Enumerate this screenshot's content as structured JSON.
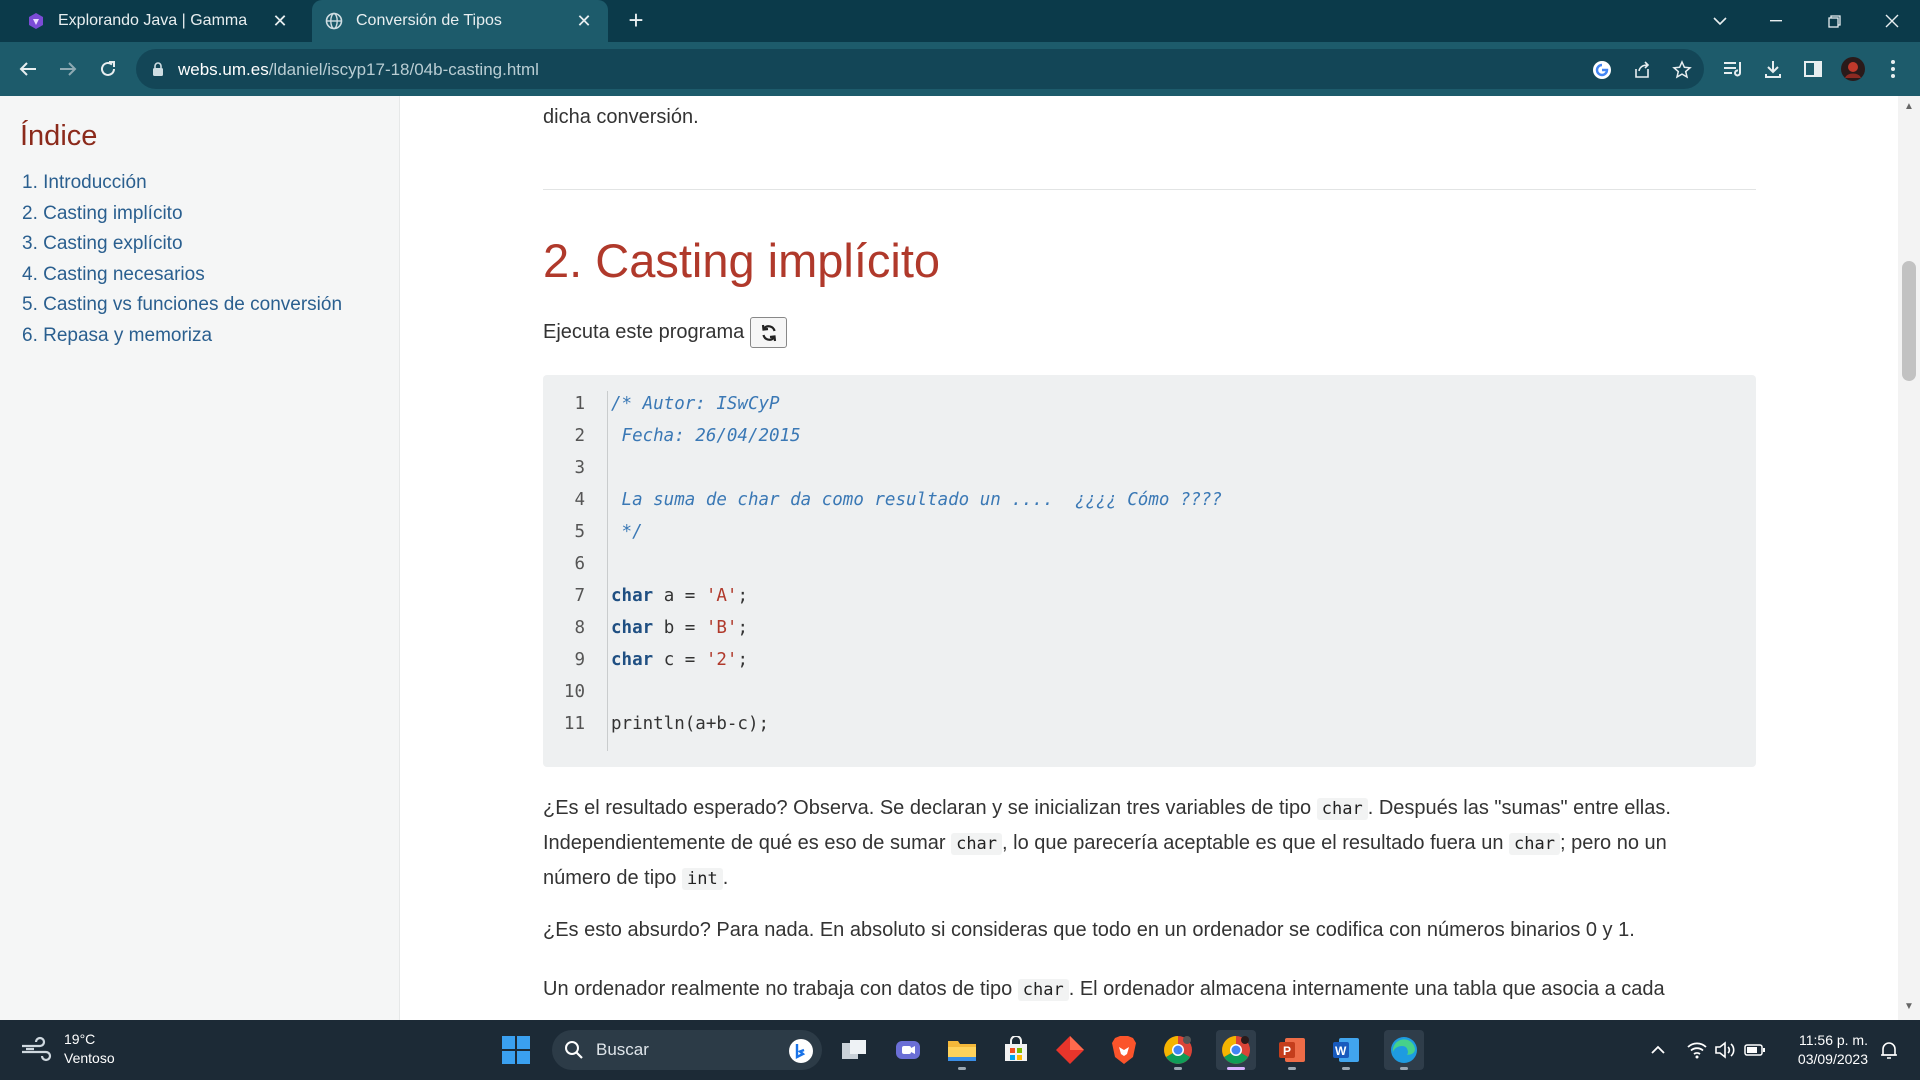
{
  "browser": {
    "tabs": [
      {
        "title": "Explorando Java | Gamma",
        "active": false,
        "icon": "gamma-icon"
      },
      {
        "title": "Conversión de Tipos",
        "active": true,
        "icon": "globe-icon"
      }
    ],
    "url_host": "webs.um.es",
    "url_path": "/ldaniel/iscyp17-18/04b-casting.html"
  },
  "sidebar": {
    "heading": "Índice",
    "items": [
      {
        "label": "1. Introducción"
      },
      {
        "label": "2. Casting implícito"
      },
      {
        "label": "3. Casting explícito"
      },
      {
        "label": "4. Casting necesarios"
      },
      {
        "label": "5. Casting vs funciones de conversión"
      },
      {
        "label": "6. Repasa y memoriza"
      }
    ]
  },
  "main": {
    "intro_tail": "dicha conversión.",
    "section_title": "2. Casting implícito",
    "run_prompt": "Ejecuta este programa",
    "code": {
      "line_numbers": [
        "1",
        "2",
        "3",
        "4",
        "5",
        "6",
        "7",
        "8",
        "9",
        "10",
        "11"
      ],
      "comment_lines": [
        "/* Autor: ISwCyP",
        " Fecha: 26/04/2015",
        "",
        " La suma de char da como resultado un ....  ¿¿¿¿ Cómo ????",
        " */"
      ],
      "decls": [
        {
          "kw": "char",
          "rest": " a = ",
          "lit": "'A'",
          "end": ";"
        },
        {
          "kw": "char",
          "rest": " b = ",
          "lit": "'B'",
          "end": ";"
        },
        {
          "kw": "char",
          "rest": " c = ",
          "lit": "'2'",
          "end": ";"
        }
      ],
      "last_line": "println(a+b-c);"
    },
    "p1": {
      "a": "¿Es el resultado esperado? Observa. Se declaran y se inicializan tres variables de tipo ",
      "code1": "char",
      "b": ". Después las \"sumas\" entre ellas.",
      "c": "Independientemente de qué es eso de sumar ",
      "code2": "char",
      "d": ", lo que parecería aceptable es que el resultado fuera un ",
      "code3": "char",
      "e": "; pero no un",
      "f": "número de tipo ",
      "code4": "int",
      "g": "."
    },
    "p2": "¿Es esto absurdo? Para nada. En absoluto si consideras que todo en un ordenador se codifica con números binarios 0 y 1.",
    "p3": {
      "a": "Un ordenador realmente no trabaja con datos de tipo ",
      "code1": "char",
      "b": ". El ordenador almacena internamente una tabla que asocia a cada"
    }
  },
  "taskbar": {
    "weather_temp": "19°C",
    "weather_desc": "Ventoso",
    "search_label": "Buscar",
    "time": "11:56 p. m.",
    "date": "03/09/2023"
  }
}
